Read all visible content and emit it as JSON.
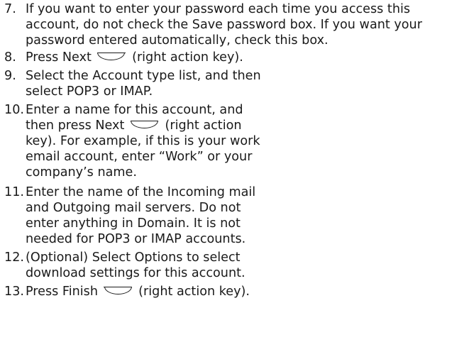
{
  "steps": [
    {
      "number": "7.",
      "text": "If you want to enter your password each time you access this account, do not check the Save password box. If you want your password entered automatically, check this box."
    },
    {
      "number": "8.",
      "before": "Press Next",
      "icon": "right-action-key-icon",
      "after": "(right action key)."
    },
    {
      "number": "9.",
      "text": "Select the Account type list, and then select POP3 or IMAP."
    },
    {
      "number": "10.",
      "before": "Enter a name for this account, and then press Next",
      "icon": "right-action-key-icon",
      "after": "(right action key). For example, if this is your work email account, enter “Work” or your company’s name."
    },
    {
      "number": "11.",
      "text": "Enter the name of the Incoming mail and Outgoing mail servers. Do not enter anything in Domain. It is not needed for POP3 or IMAP accounts."
    },
    {
      "number": "12.",
      "text": "(Optional) Select Options to select download settings for this account."
    },
    {
      "number": "13.",
      "before": "Press Finish",
      "icon": "right-action-key-icon",
      "after": "(right action key)."
    }
  ]
}
